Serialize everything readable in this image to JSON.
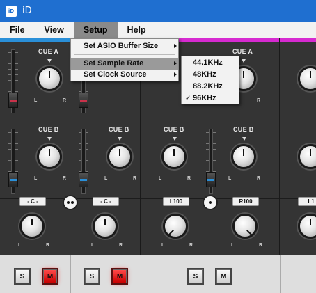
{
  "window": {
    "title": "iD",
    "icon_label": "iD"
  },
  "menubar": {
    "items": [
      "File",
      "View",
      "Setup",
      "Help"
    ],
    "open": "Setup"
  },
  "setup_menu": {
    "items": [
      {
        "label": "Set ASIO Buffer Size",
        "has_submenu": true
      },
      {
        "label": "Set Sample Rate",
        "has_submenu": true,
        "highlighted": true
      },
      {
        "label": "Set Clock Source",
        "has_submenu": true
      }
    ]
  },
  "sample_rate_menu": {
    "items": [
      "44.1KHz",
      "48KHz",
      "88.2KHz",
      "96KHz"
    ],
    "selected": "96KHz",
    "check_glyph": "✓"
  },
  "mixer": {
    "cue_a_label": "CUE A",
    "cue_b_label": "CUE B",
    "knob_left": "L",
    "knob_right": "R",
    "solo_label": "S",
    "mute_label": "M",
    "channel_colors": [
      "#2a8fd8",
      "#d62ad0"
    ],
    "channels": [
      {
        "pan": "- C -",
        "mute_on": true
      },
      {
        "pan": "- C -",
        "mute_on": true
      },
      {
        "pan": "L100",
        "mute_on": false
      },
      {
        "pan": "R100",
        "mute_on": false
      },
      {
        "pan": "L1",
        "mute_on": false
      }
    ]
  }
}
